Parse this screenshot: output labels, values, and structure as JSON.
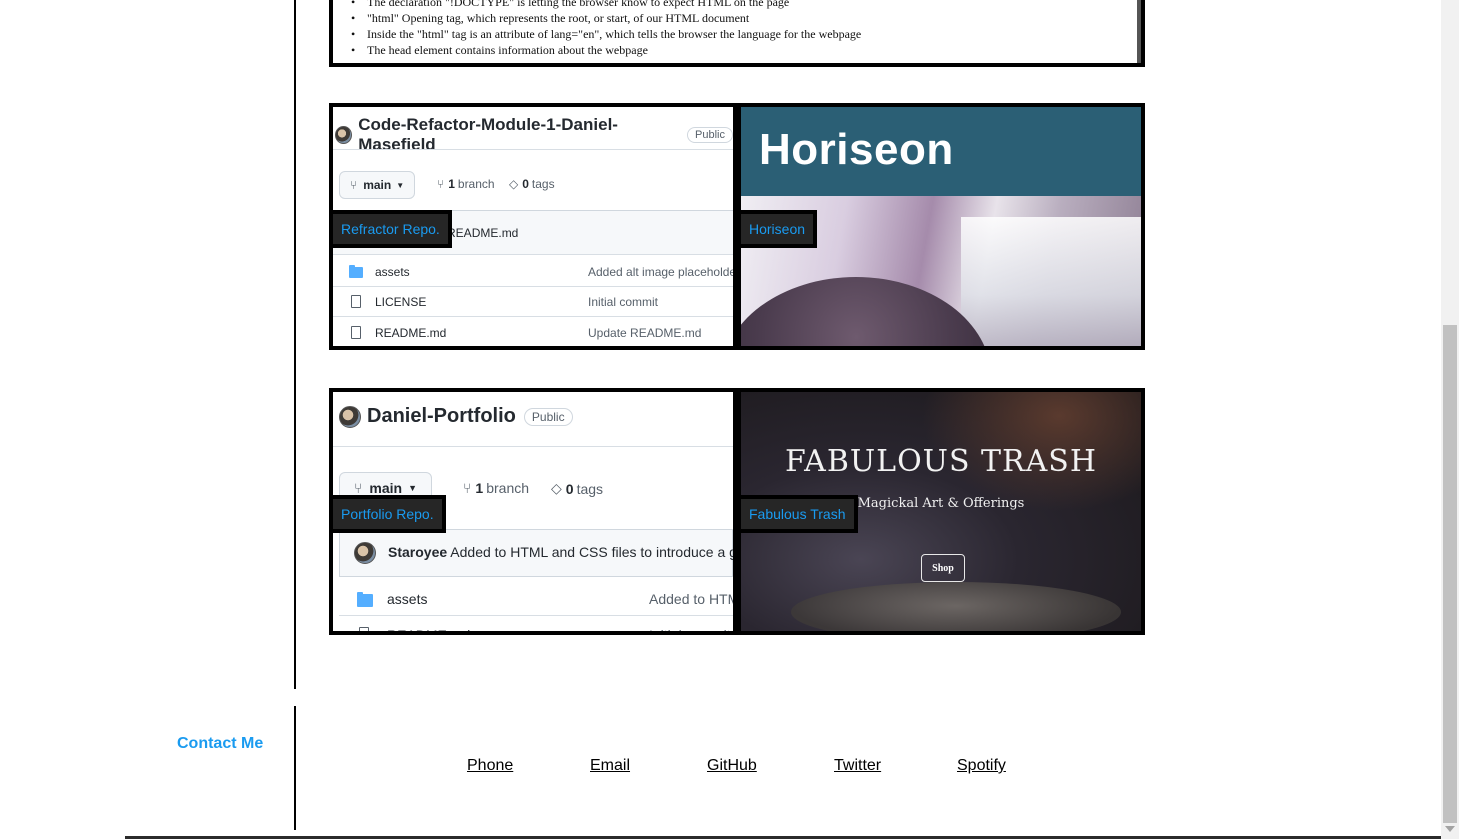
{
  "code_snippet": {
    "lines": [
      "The declaration \"!DOCTYPE\" is letting the browser know to expect HTML on the page",
      "\"html\" Opening tag, which represents the root, or start, of our HTML document",
      "Inside the \"html\" tag is an attribute of lang=\"en\", which tells the browser the language for the webpage",
      "The head element contains information about the webpage"
    ]
  },
  "projects": [
    {
      "label": "Refractor Repo.",
      "repo": {
        "name": "Code-Refactor-Module-1-Daniel-Masefield",
        "visibility": "Public",
        "branch": "main",
        "branch_count": "1",
        "branch_word": "branch",
        "tag_count": "0",
        "tag_word": "tags",
        "commit_msg": "ate README.md",
        "rows": [
          {
            "name": "assets",
            "msg": "Added alt image placeholder"
          },
          {
            "name": "LICENSE",
            "msg": "Initial commit"
          },
          {
            "name": "README.md",
            "msg": "Update README.md"
          }
        ]
      }
    },
    {
      "label": "Horiseon",
      "site_title": "Horiseon"
    },
    {
      "label": "Portfolio Repo.",
      "repo": {
        "name": "Daniel-Portfolio",
        "visibility": "Public",
        "branch": "main",
        "branch_count": "1",
        "branch_word": "branch",
        "tag_count": "0",
        "tag_word": "tags",
        "commit_user": "Staroyee",
        "commit_msg": "Added to HTML and CSS files to introduce a g",
        "rows": [
          {
            "name": "assets",
            "msg": "Added to HTM"
          },
          {
            "name": "README.md",
            "msg": "Initial commit"
          }
        ]
      }
    },
    {
      "label": "Fabulous Trash",
      "site_title": "FABULOUS TRASH",
      "site_subtitle": "Magickal Art & Offerings",
      "site_button": "Shop"
    }
  ],
  "contact": {
    "heading": "Contact Me",
    "links": [
      "Phone",
      "Email",
      "GitHub",
      "Twitter",
      "Spotify"
    ]
  },
  "colors": {
    "accent": "#1a9bf0",
    "label_bg": "#262626",
    "border": "#000000"
  }
}
